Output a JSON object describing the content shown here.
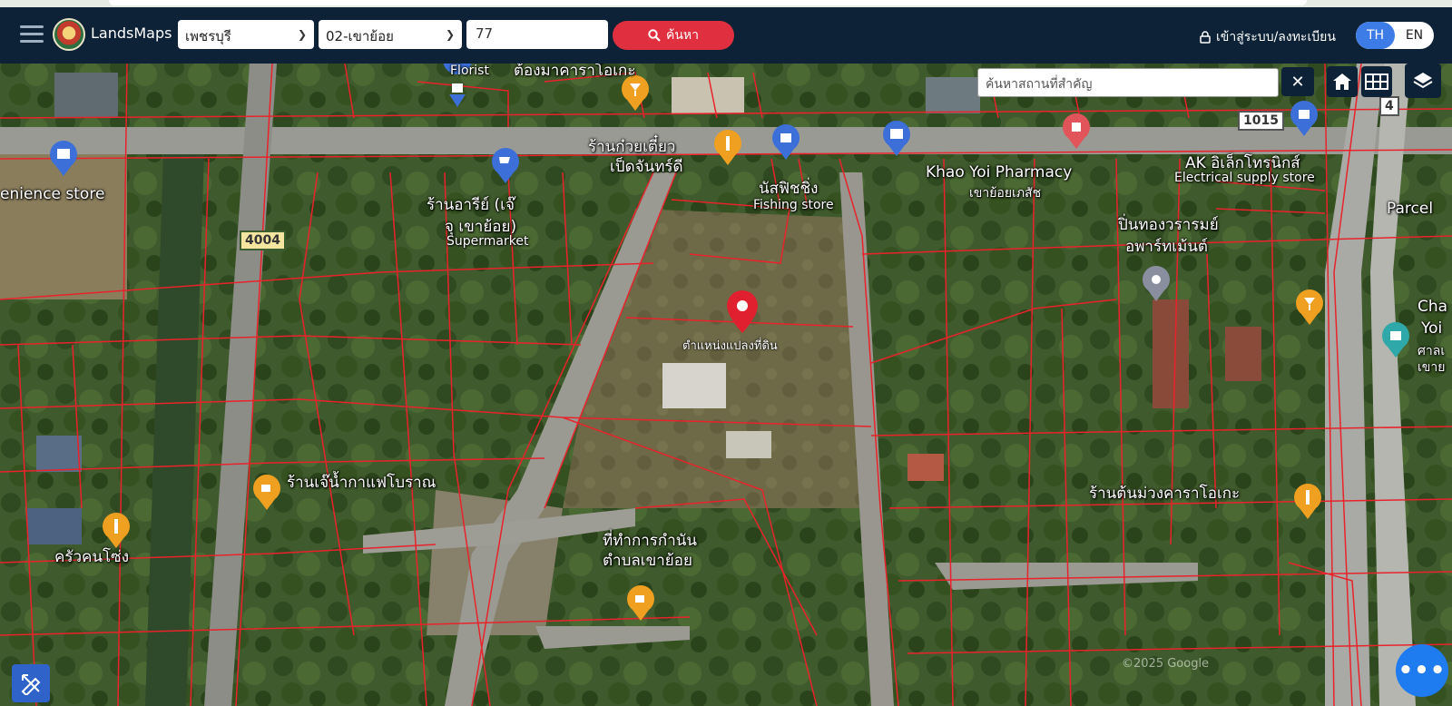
{
  "header": {
    "brand": "LandsMaps",
    "province_select": "เพชรบุรี",
    "district_select": "02-เขาย้อย",
    "parcel_input": "77",
    "search_label": "ค้นหา",
    "login_label": "เข้าสู่ระบบ/ลงทะเบียน",
    "lang_th": "TH",
    "lang_en": "EN"
  },
  "map": {
    "place_search_placeholder": "ค้นหาสถานที่สำคัญ",
    "clear_label": "✕",
    "pin_label": "ตำแหน่งแปลงที่ดิน",
    "colors": {
      "parcel_line": "#e8232b",
      "poi_blue": "#3c6fd8",
      "poi_orange": "#f0a020",
      "pin_red": "#e0202f",
      "navbar": "#0d2236"
    },
    "road_shields": {
      "r4004": "4004",
      "r1015": "1015",
      "r4": "4"
    },
    "labels": {
      "florist": "Florist",
      "karaoke_top": "ต้องมาคาราโอเกะ",
      "convenience": "enience store",
      "noodle_1": "ร้านก๋วยเตี๋ยว",
      "noodle_2": "เป็ดจันทร์ดี",
      "fishing_th": "นัสฟิชชิ่ง",
      "fishing_en": "Fishing store",
      "supermarket_th1": "ร้านอารีย์ (เจ๊",
      "supermarket_th2": "จุ เขาย้อย)",
      "supermarket_en": "Supermarket",
      "pharmacy_en": "Khao Yoi Pharmacy",
      "pharmacy_th": "เขาย้อยเภสัช",
      "ak_th": "AK อิเล็กโทรนิกส์",
      "ak_en": "Electrical supply store",
      "parcel": "Parcel",
      "apartment_1": "ปิ่นทองวรารมย์",
      "apartment_2": "อพาร์ทเม้นต์",
      "cha_1": "Cha",
      "cha_2": "Yoi",
      "cha_3": "ศาลเ",
      "cha_4": "เขาย",
      "coffee": "ร้านเจ๊น้ำกาแฟโบราณ",
      "karaoke_right": "ร้านต้นม่วงคาราโอเกะ",
      "kitchen": "ครัวคนโซ่ง",
      "kamnan_1": "ที่ทำการกำนัน",
      "kamnan_2": "ตำบลเขาย้อย"
    },
    "watermark": "©2025 Google"
  }
}
